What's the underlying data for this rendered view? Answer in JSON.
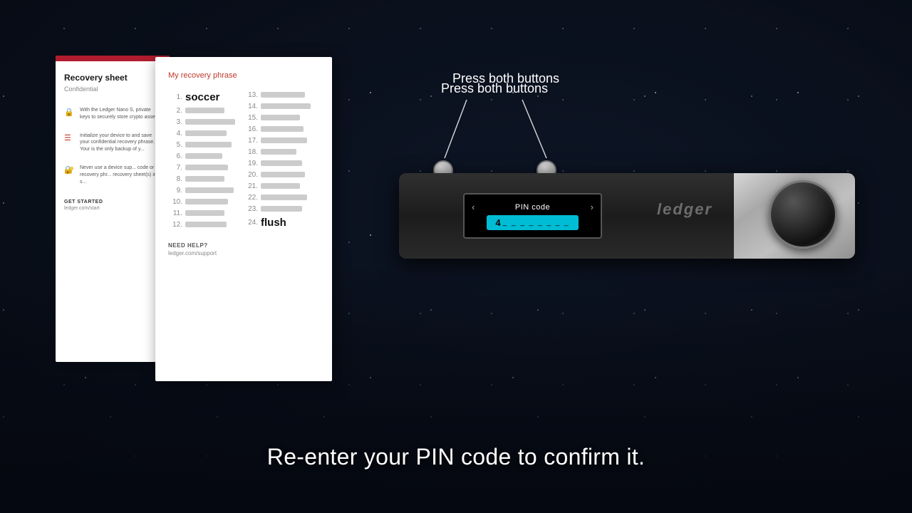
{
  "background": {
    "color": "#0a0e1a"
  },
  "recovery_sheet_bg": {
    "title": "Recovery sheet",
    "subtitle": "Confidential",
    "red_bar": true,
    "icon_texts": [
      "With the Ledger Nano S, private keys to securely store crypto assets.",
      "Initialize your device to and save your confidential recovery phrase. Your is the only backup of y...",
      "Never use a device sup... code or a recovery phr... recovery sheet(s) in a s..."
    ],
    "get_started_label": "GET STARTED",
    "get_link": "ledger.com/start"
  },
  "recovery_card": {
    "title": "My recovery phrase",
    "words": [
      {
        "num": "1.",
        "word": "soccer",
        "blurred": false
      },
      {
        "num": "2.",
        "word": "",
        "blurred": true
      },
      {
        "num": "3.",
        "word": "",
        "blurred": true
      },
      {
        "num": "4.",
        "word": "",
        "blurred": true
      },
      {
        "num": "5.",
        "word": "",
        "blurred": true
      },
      {
        "num": "6.",
        "word": "",
        "blurred": true
      },
      {
        "num": "7.",
        "word": "",
        "blurred": true
      },
      {
        "num": "8.",
        "word": "",
        "blurred": true
      },
      {
        "num": "9.",
        "word": "",
        "blurred": true
      },
      {
        "num": "10.",
        "word": "",
        "blurred": true
      },
      {
        "num": "11.",
        "word": "",
        "blurred": true
      },
      {
        "num": "12.",
        "word": "",
        "blurred": true
      },
      {
        "num": "13.",
        "word": "",
        "blurred": true
      },
      {
        "num": "14.",
        "word": "",
        "blurred": true
      },
      {
        "num": "15.",
        "word": "",
        "blurred": true
      },
      {
        "num": "16.",
        "word": "",
        "blurred": true
      },
      {
        "num": "17.",
        "word": "",
        "blurred": true
      },
      {
        "num": "18.",
        "word": "",
        "blurred": true
      },
      {
        "num": "19.",
        "word": "",
        "blurred": true
      },
      {
        "num": "20.",
        "word": "",
        "blurred": true
      },
      {
        "num": "21.",
        "word": "",
        "blurred": true
      },
      {
        "num": "22.",
        "word": "",
        "blurred": true
      },
      {
        "num": "23.",
        "word": "",
        "blurred": true
      },
      {
        "num": "24.",
        "word": "flush",
        "blurred": false
      }
    ],
    "need_help_label": "NEED HELP?",
    "help_link": "ledger.com/support"
  },
  "device": {
    "press_label": "Press both buttons",
    "screen_title": "PIN code",
    "pin_digit": "4",
    "pin_dashes": "_ _ _ _ _ _ _ _"
  },
  "subtitle": "Re-enter your PIN code to confirm it."
}
